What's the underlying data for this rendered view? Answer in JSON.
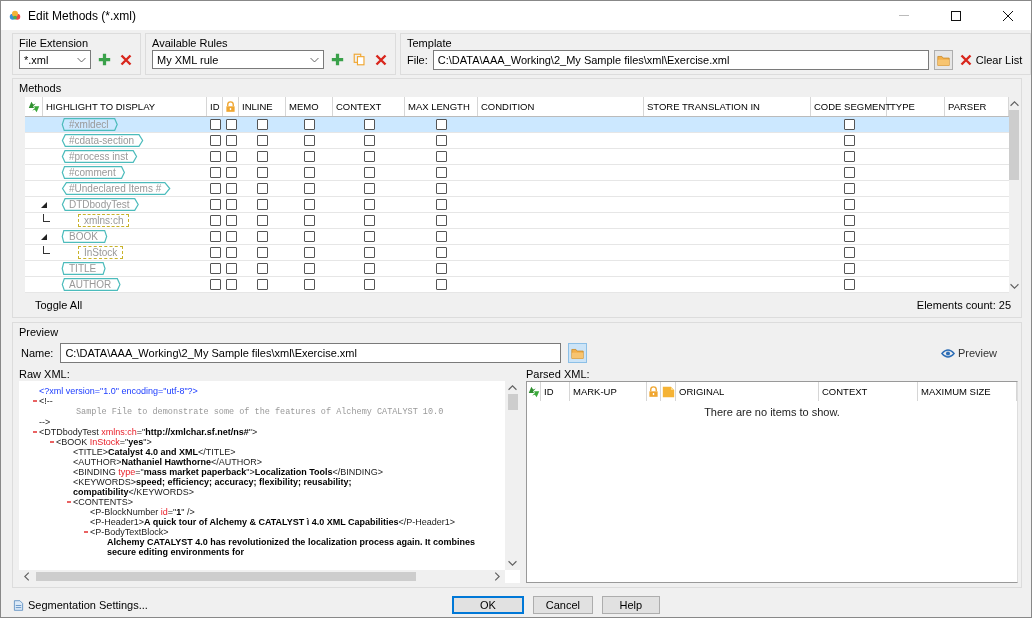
{
  "window": {
    "title": "Edit Methods (*.xml)"
  },
  "file_extension": {
    "label": "File Extension",
    "value": "*.xml"
  },
  "available_rules": {
    "label": "Available Rules",
    "value": "My XML rule"
  },
  "template": {
    "label": "Template",
    "file_label": "File:",
    "value": "C:\\DATA\\AAA_Working\\2_My Sample files\\xml\\Exercise.xml",
    "clear_button": "Clear List"
  },
  "methods": {
    "label": "Methods",
    "columns": [
      {
        "kind": "refresh"
      },
      {
        "kind": "name",
        "label": "HIGHLIGHT TO DISPLAY"
      },
      {
        "kind": "check",
        "label": "ID"
      },
      {
        "kind": "lock"
      },
      {
        "kind": "check",
        "label": "INLINE"
      },
      {
        "kind": "check",
        "label": "MEMO"
      },
      {
        "kind": "check",
        "label": "CONTEXT"
      },
      {
        "kind": "check",
        "label": "MAX LENGTH"
      },
      {
        "kind": "text",
        "label": "CONDITION"
      },
      {
        "kind": "text",
        "label": "STORE TRANSLATION IN"
      },
      {
        "kind": "check",
        "label": "CODE SEGMENT"
      },
      {
        "kind": "text",
        "label": "TYPE"
      },
      {
        "kind": "text",
        "label": "PARSER"
      }
    ],
    "rows": [
      {
        "name": "#xmldecl",
        "kind": "element",
        "selected": true,
        "checks": [
          false,
          false,
          false,
          false,
          false,
          false,
          false
        ]
      },
      {
        "name": "#cdata-section",
        "kind": "element",
        "selected": false,
        "checks": [
          false,
          false,
          false,
          false,
          false,
          false,
          false
        ]
      },
      {
        "name": "#process inst",
        "kind": "element",
        "selected": false,
        "checks": [
          false,
          false,
          false,
          false,
          false,
          false,
          false
        ]
      },
      {
        "name": "#comment",
        "kind": "element",
        "selected": false,
        "checks": [
          false,
          false,
          false,
          false,
          false,
          false,
          false
        ]
      },
      {
        "name": "#Undeclared Items #",
        "kind": "element",
        "selected": false,
        "checks": [
          false,
          false,
          false,
          false,
          false,
          false,
          false
        ]
      },
      {
        "name": "DTDbodyTest",
        "kind": "element",
        "selected": false,
        "expanded": true,
        "checks": [
          false,
          false,
          false,
          false,
          false,
          false,
          false
        ],
        "children": [
          {
            "name": "xmlns:ch",
            "kind": "attribute",
            "selected": false,
            "checks": [
              false,
              false,
              false,
              false,
              false,
              false,
              false
            ]
          }
        ]
      },
      {
        "name": "BOOK",
        "kind": "element",
        "selected": false,
        "expanded": true,
        "checks": [
          false,
          false,
          false,
          false,
          false,
          false,
          false
        ],
        "children": [
          {
            "name": "InStock",
            "kind": "attribute",
            "selected": false,
            "checks": [
              false,
              false,
              false,
              false,
              false,
              false,
              false
            ]
          }
        ]
      },
      {
        "name": "TITLE",
        "kind": "element",
        "selected": false,
        "checks": [
          false,
          false,
          false,
          false,
          false,
          false,
          false
        ]
      },
      {
        "name": "AUTHOR",
        "kind": "element",
        "selected": false,
        "checks": [
          false,
          false,
          false,
          false,
          false,
          false,
          false
        ]
      }
    ],
    "toggle_all": "Toggle All",
    "count": "Elements count: 25"
  },
  "preview": {
    "label": "Preview",
    "name_label": "Name:",
    "name_value": "C:\\DATA\\AAA_Working\\2_My Sample files\\xml\\Exercise.xml",
    "preview_button": "Preview",
    "raw_label": "Raw XML:",
    "raw_xml": [
      {
        "segments": [
          {
            "kind": "pi",
            "text": "<?xml version=\"1.0\" encoding=\"utf-8\"?>"
          }
        ]
      },
      {
        "expanded": true,
        "segments": [
          {
            "kind": "tag",
            "text": "<!--"
          }
        ],
        "children": [
          {
            "segments": [
              {
                "kind": "comment",
                "text": "Sample File to demonstrate some of the features of Alchemy CATALYST 10.0"
              }
            ]
          }
        ],
        "close": [
          {
            "kind": "tag",
            "text": "-->"
          }
        ]
      },
      {
        "expanded": true,
        "segments": [
          {
            "kind": "tag",
            "text": "<DTDbodyTest "
          },
          {
            "kind": "attr",
            "text": "xmlns:ch"
          },
          {
            "kind": "tag",
            "text": "=\""
          },
          {
            "kind": "value",
            "text": "http://xmlchar.sf.net/ns#"
          },
          {
            "kind": "tag",
            "text": "\">"
          }
        ],
        "children": [
          {
            "expanded": true,
            "segments": [
              {
                "kind": "tag",
                "text": "<BOOK "
              },
              {
                "kind": "attr",
                "text": "InStock"
              },
              {
                "kind": "tag",
                "text": "=\""
              },
              {
                "kind": "value",
                "text": "yes"
              },
              {
                "kind": "tag",
                "text": "\">"
              }
            ],
            "children": [
              {
                "segments": [
                  {
                    "kind": "tag",
                    "text": "<TITLE>"
                  },
                  {
                    "kind": "text",
                    "text": "Catalyst 4.0 and XML"
                  },
                  {
                    "kind": "tag",
                    "text": "</TITLE>"
                  }
                ]
              },
              {
                "segments": [
                  {
                    "kind": "tag",
                    "text": "<AUTHOR>"
                  },
                  {
                    "kind": "text",
                    "text": "Nathaniel Hawthorne"
                  },
                  {
                    "kind": "tag",
                    "text": "</AUTHOR>"
                  }
                ]
              },
              {
                "segments": [
                  {
                    "kind": "tag",
                    "text": "<BINDING "
                  },
                  {
                    "kind": "attr",
                    "text": "type"
                  },
                  {
                    "kind": "tag",
                    "text": "=\""
                  },
                  {
                    "kind": "value",
                    "text": "mass market paperback"
                  },
                  {
                    "kind": "tag",
                    "text": "\">"
                  },
                  {
                    "kind": "text",
                    "text": "Localization Tools"
                  },
                  {
                    "kind": "tag",
                    "text": "</BINDING>"
                  }
                ]
              },
              {
                "segments": [
                  {
                    "kind": "tag",
                    "text": "<KEYWORDS>"
                  },
                  {
                    "kind": "text",
                    "text": "speed; efficiency; accuracy; flexibility; reusability; compatibility"
                  },
                  {
                    "kind": "tag",
                    "text": "</KEYWORDS>"
                  }
                ]
              },
              {
                "expanded": true,
                "segments": [
                  {
                    "kind": "tag",
                    "text": "<CONTENTS>"
                  }
                ],
                "children": [
                  {
                    "segments": [
                      {
                        "kind": "tag",
                        "text": "<P-BlockNumber "
                      },
                      {
                        "kind": "attr",
                        "text": "id"
                      },
                      {
                        "kind": "tag",
                        "text": "=\""
                      },
                      {
                        "kind": "value",
                        "text": "1"
                      },
                      {
                        "kind": "tag",
                        "text": "\" />"
                      }
                    ]
                  },
                  {
                    "segments": [
                      {
                        "kind": "tag",
                        "text": "<P-Header1>"
                      },
                      {
                        "kind": "text",
                        "text": "A quick tour of Alchemy & CATALYST ì 4.0 XML Capabilities"
                      },
                      {
                        "kind": "tag",
                        "text": "</P-Header1>"
                      }
                    ]
                  },
                  {
                    "expanded": true,
                    "segments": [
                      {
                        "kind": "tag",
                        "text": "<P-BodyTextBlock>"
                      }
                    ],
                    "children": [
                      {
                        "segments": [
                          {
                            "kind": "text",
                            "text": "Alchemy CATALYST 4.0 has revolutionized the localization process again. It combines secure editing environments for"
                          }
                        ]
                      }
                    ]
                  }
                ]
              }
            ]
          }
        ]
      }
    ],
    "parsed_label": "Parsed XML:",
    "parsed_columns": [
      {
        "kind": "refresh"
      },
      {
        "kind": "text",
        "label": "ID"
      },
      {
        "kind": "text",
        "label": "MARK-UP"
      },
      {
        "kind": "lock"
      },
      {
        "kind": "note"
      },
      {
        "kind": "text",
        "label": "ORIGINAL"
      },
      {
        "kind": "text",
        "label": "CONTEXT"
      },
      {
        "kind": "text",
        "label": "MAXIMUM SIZE"
      }
    ],
    "empty_message": "There are no items to show."
  },
  "footer": {
    "segmentation": "Segmentation Settings...",
    "buttons": [
      {
        "label": "OK",
        "default": true
      },
      {
        "label": "Cancel",
        "default": false
      },
      {
        "label": "Help",
        "default": false
      }
    ]
  }
}
